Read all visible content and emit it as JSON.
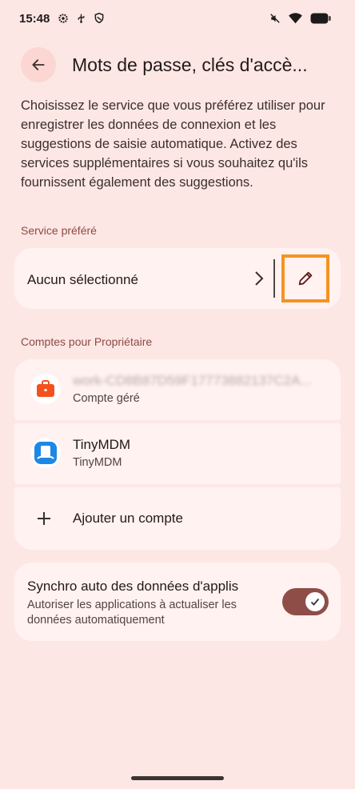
{
  "status_bar": {
    "time": "15:48",
    "left_icons": [
      "settings-icon",
      "usb-icon",
      "shield-icon"
    ],
    "right_icons": [
      "mute-icon",
      "wifi-icon",
      "battery-icon"
    ]
  },
  "header": {
    "title": "Mots de passe, clés d'accè...",
    "back_icon": "arrow-back-icon"
  },
  "intro_text": "Choisissez le service que vous préférez utiliser pour enregistrer les données de connexion et les suggestions de saisie automatique. Activez des services supplémentaires si vous souhaitez qu'ils fournissent également des suggestions.",
  "preferred_service": {
    "section_label": "Service préféré",
    "value": "Aucun sélectionné",
    "chevron_icon": "chevron-right-icon",
    "edit_icon": "pencil-icon"
  },
  "accounts": {
    "section_label": "Comptes pour Propriétaire",
    "items": [
      {
        "title": "work-CD8B87D59F17773882137C2A...",
        "subtitle": "Compte géré",
        "icon": "briefcase-icon",
        "icon_color": "#f4511e"
      },
      {
        "title": "TinyMDM",
        "subtitle": "TinyMDM",
        "icon": "tinymdm-app-icon",
        "icon_color": "#1e88e5"
      }
    ],
    "add_label": "Ajouter un compte",
    "add_icon": "plus-icon"
  },
  "sync": {
    "title": "Synchro auto des données d'applis",
    "subtitle": "Autoriser les applications à actualiser les données automatiquement",
    "enabled": true
  },
  "colors": {
    "background": "#fde7e5",
    "card": "#fff2f1",
    "accent": "#8f4d47",
    "highlight": "#f59320"
  }
}
